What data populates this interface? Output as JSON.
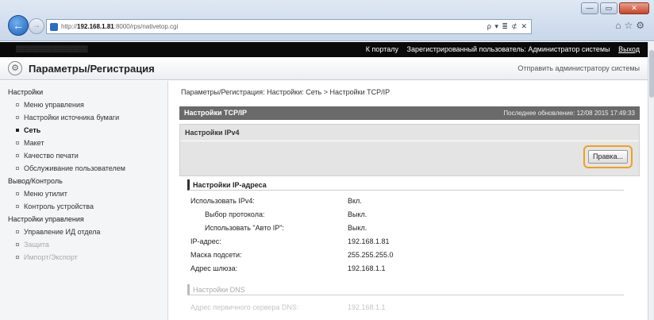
{
  "browser": {
    "address_prefix": "http://",
    "address_host": "192.168.1.81",
    "address_rest": ":8000/rps/nativetop.cgi",
    "search_label": "ρ ▾ ≣ ⊄ ✕",
    "window_buttons": [
      "—",
      "▭",
      "✕"
    ]
  },
  "topbar": {
    "portal_link": "К порталу",
    "user_text": "Зарегистрированный пользователь: Администратор системы",
    "logout": "Выход"
  },
  "header": {
    "title": "Параметры/Регистрация",
    "mail_admin": "Отправить администратору системы"
  },
  "sidebar": {
    "sections": [
      {
        "label": "Настройки",
        "items": [
          "Меню управления",
          "Настройки источника бумаги",
          "Сеть",
          "Макет",
          "Качество печати",
          "Обслуживание пользователем"
        ]
      },
      {
        "label": "Вывод/Контроль",
        "items": [
          "Меню утилит",
          "Контроль устройства"
        ]
      },
      {
        "label": "Настройки управления",
        "items": [
          "Управление ИД отдела",
          "Защита",
          "Импорт/Экспорт"
        ]
      }
    ],
    "active_item": "Сеть"
  },
  "main": {
    "breadcrumb": "Параметры/Регистрация: Настройки: Сеть > Настройки TCP/IP",
    "panel_title": "Настройки TCP/IP",
    "last_update": "Последнее обновление: 12/08 2015 17:49:33",
    "ipv4_title": "Настройки IPv4",
    "edit_button": "Правка...",
    "ip_section": "Настройки IP-адреса",
    "rows": [
      {
        "label": "Использовать IPv4:",
        "value": "Вкл."
      },
      {
        "label": "Выбор протокола:",
        "value": "Выкл."
      },
      {
        "label": "Использовать \"Авто IP\":",
        "value": "Выкл."
      },
      {
        "label": "IP-адрес:",
        "value": "192.168.1.81"
      },
      {
        "label": "Маска подсети:",
        "value": "255.255.255.0"
      },
      {
        "label": "Адрес шлюза:",
        "value": "192.168.1.1"
      }
    ],
    "dns_section": "Настройки DNS",
    "dns_row": {
      "label": "Адрес первичного сервера DNS:",
      "value": "192.168.1.1"
    }
  },
  "colors": {
    "highlight": "#f0a020",
    "panel_header": "#6a6a6a",
    "portal_bar": "#0a0a0a"
  }
}
